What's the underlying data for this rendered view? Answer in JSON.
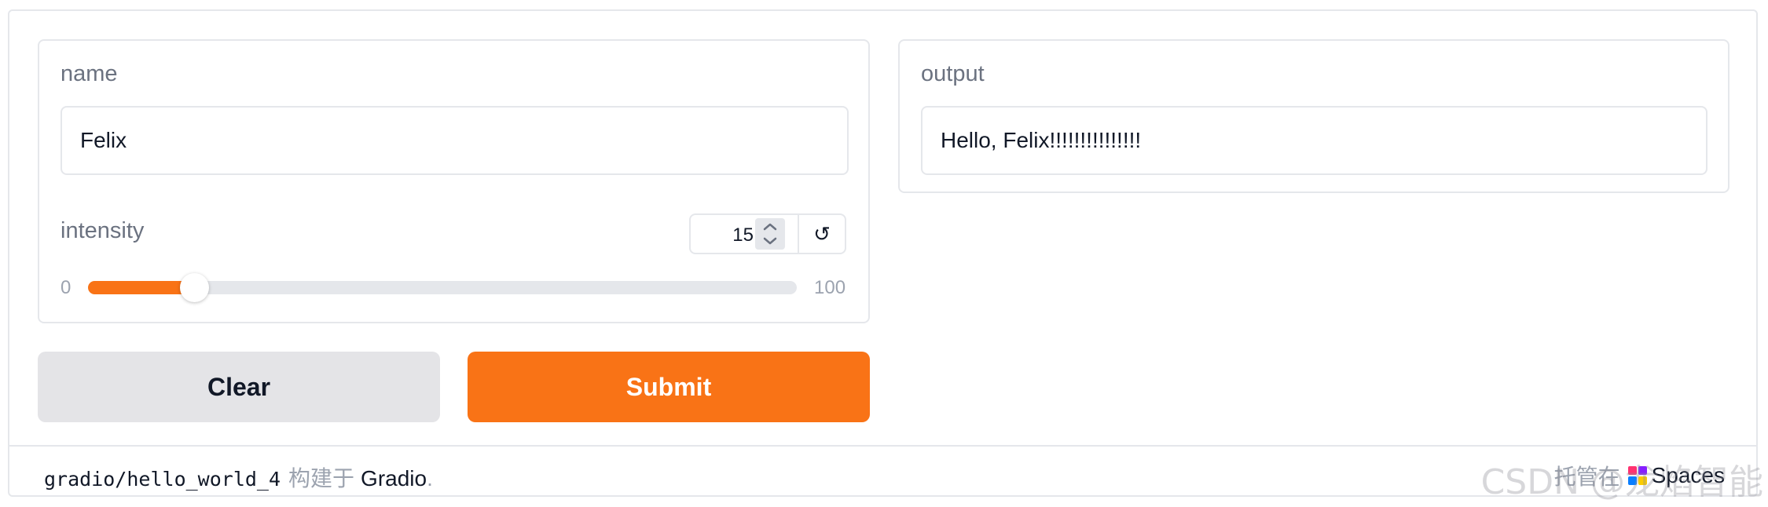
{
  "inputs": {
    "name_label": "name",
    "name_value": "Felix",
    "intensity_label": "intensity",
    "intensity_value": "15",
    "intensity_min": "0",
    "intensity_max": "100",
    "intensity_fraction": 0.15,
    "reset_glyph": "↺"
  },
  "outputs": {
    "output_label": "output",
    "output_value": "Hello, Felix!!!!!!!!!!!!!!!"
  },
  "buttons": {
    "clear_label": "Clear",
    "submit_label": "Submit"
  },
  "footer": {
    "space_name": "gradio/hello_world_4",
    "built_with": "构建于",
    "gradio": "Gradio",
    "dot": ".",
    "hosted_on": "托管在",
    "spaces": "Spaces"
  },
  "watermark": "CSDN @龙焰智能",
  "colors": {
    "accent": "#f97316",
    "clear_bg": "#e4e4e7",
    "border": "#e5e7eb",
    "label": "#6b7280"
  }
}
